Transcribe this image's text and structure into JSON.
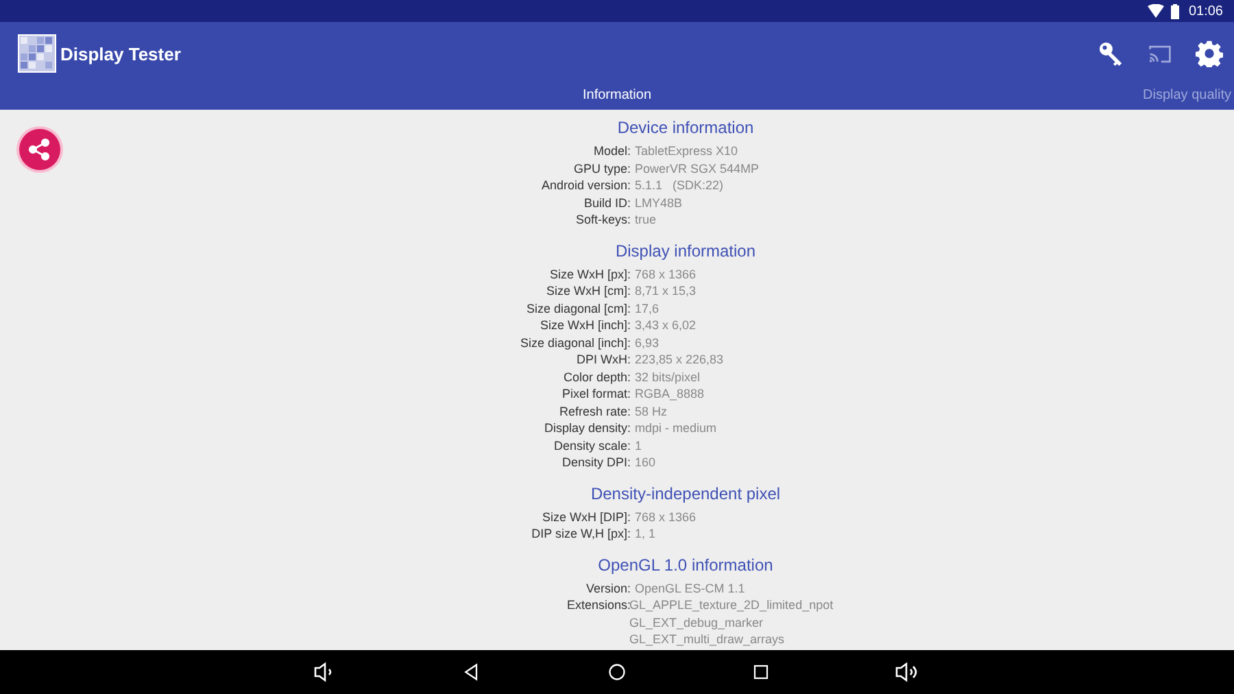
{
  "status_bar": {
    "time": "01:06"
  },
  "app_bar": {
    "title": "Display Tester"
  },
  "tabs": [
    {
      "label": "Information",
      "selected": true
    },
    {
      "label": "Display quality",
      "selected": false
    }
  ],
  "sections": [
    {
      "title": "Device information",
      "rows": [
        {
          "label": "Model:",
          "value": "TabletExpress X10"
        },
        {
          "label": "GPU type:",
          "value": "PowerVR SGX 544MP"
        },
        {
          "label": "Android version:",
          "value": "5.1.1   (SDK:22)"
        },
        {
          "label": "Build ID:",
          "value": "LMY48B"
        },
        {
          "label": "Soft-keys:",
          "value": "true"
        }
      ]
    },
    {
      "title": "Display information",
      "rows": [
        {
          "label": "Size WxH [px]:",
          "value": "768 x 1366"
        },
        {
          "label": "Size WxH [cm]:",
          "value": "8,71 x 15,3"
        },
        {
          "label": "Size diagonal [cm]:",
          "value": "17,6"
        },
        {
          "label": "Size WxH [inch]:",
          "value": "3,43 x 6,02"
        },
        {
          "label": "Size diagonal [inch]:",
          "value": "6,93"
        },
        {
          "label": "DPI WxH:",
          "value": "223,85 x 226,83"
        },
        {
          "label": "Color depth:",
          "value": "32 bits/pixel"
        },
        {
          "label": "Pixel format:",
          "value": "RGBA_8888"
        },
        {
          "label": "Refresh rate:",
          "value": "58 Hz"
        },
        {
          "label": "Display density:",
          "value": "mdpi - medium"
        },
        {
          "label": "Density scale:",
          "value": "1"
        },
        {
          "label": "Density DPI:",
          "value": "160"
        }
      ]
    },
    {
      "title": "Density-independent pixel",
      "rows": [
        {
          "label": "Size WxH [DIP]:",
          "value": "768 x 1366"
        },
        {
          "label": "DIP size W,H [px]:",
          "value": "1, 1"
        }
      ]
    },
    {
      "title": "OpenGL 1.0 information",
      "rows": [
        {
          "label": "Version:",
          "value": "OpenGL ES-CM 1.1"
        },
        {
          "label": "Extensions:",
          "value": [
            "GL_APPLE_texture_2D_limited_npot",
            "GL_EXT_debug_marker",
            "GL_EXT_multi_draw_arrays"
          ]
        }
      ]
    }
  ]
}
